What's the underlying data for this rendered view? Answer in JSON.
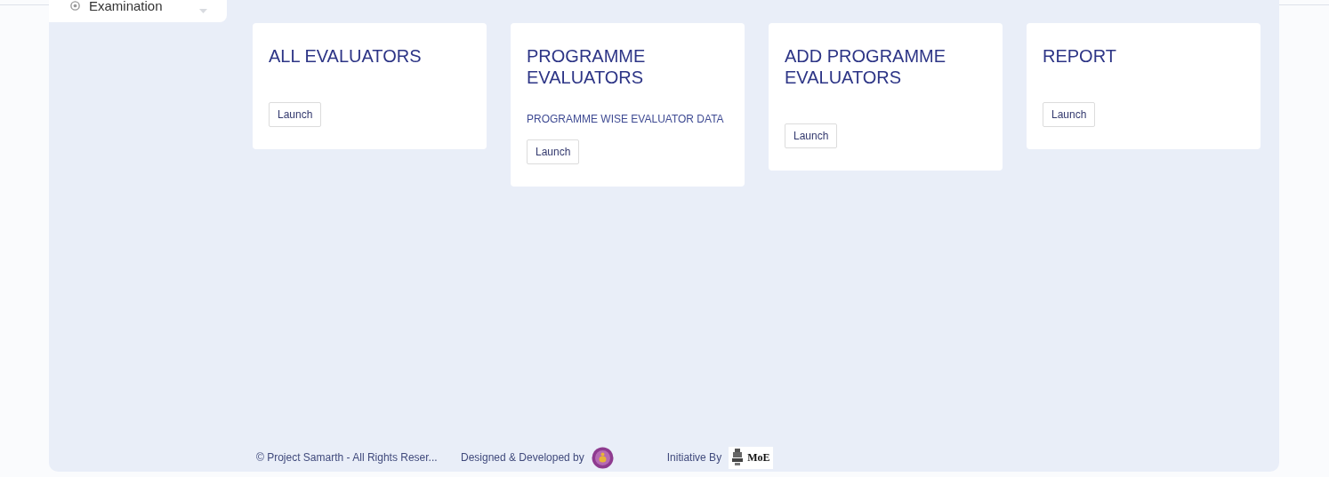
{
  "sidebar": {
    "items": [
      {
        "label": "Examination"
      }
    ]
  },
  "cards": [
    {
      "title": "ALL EVALUATORS",
      "button": "Launch"
    },
    {
      "title": "PROGRAMME EVALUATORS",
      "description": "PROGRAMME WISE EVALUATOR DATA",
      "button": "Launch"
    },
    {
      "title": "ADD PROGRAMME EVALUATORS",
      "button": "Launch"
    },
    {
      "title": "REPORT",
      "button": "Launch"
    }
  ],
  "footer": {
    "copyright": "© Project Samarth - All Rights Reser...",
    "designed_by": "Designed & Developed by",
    "initiative_by": "Initiative By",
    "ministry_logo": "MoE"
  }
}
